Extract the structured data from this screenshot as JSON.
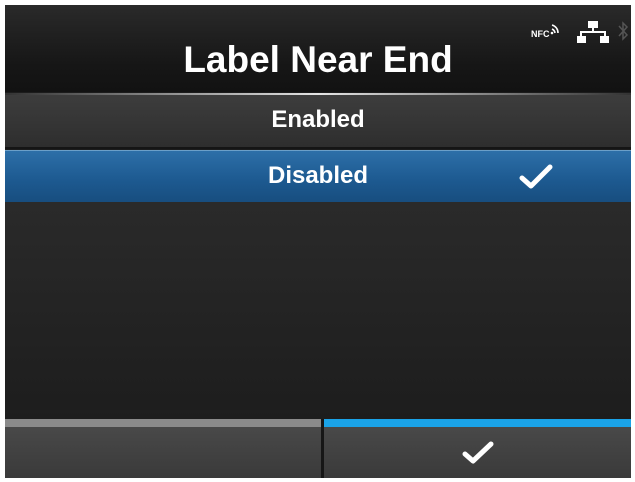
{
  "header": {
    "title": "Label Near End",
    "status_icons": {
      "nfc_label": "NFC",
      "nfc_icon": "nfc-icon",
      "network_icon": "network-icon",
      "bluetooth_icon": "bluetooth-icon"
    }
  },
  "list": {
    "items": [
      {
        "label": "Enabled",
        "selected": false
      },
      {
        "label": "Disabled",
        "selected": true
      }
    ],
    "selected_check_icon": "checkmark-icon"
  },
  "footer": {
    "left_softkey_label": "",
    "right_softkey_icon": "checkmark-icon"
  },
  "colors": {
    "background": "#1c1c1c",
    "selected_row": "#1d5a91",
    "accent_bar": "#1aa3e8",
    "inactive_bar": "#8a8a8a",
    "text": "#ffffff"
  }
}
